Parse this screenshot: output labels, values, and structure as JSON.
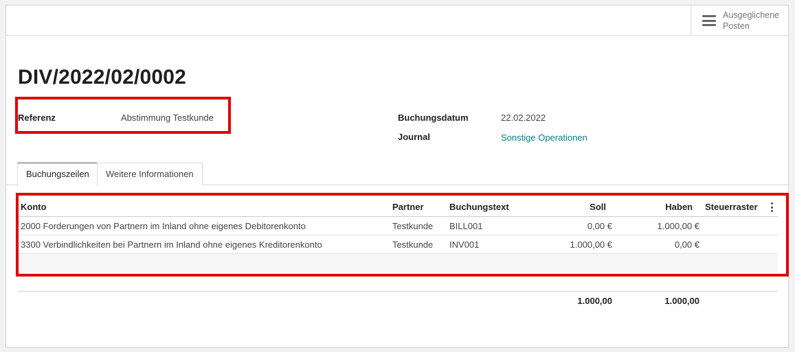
{
  "smart_button": {
    "label": "Ausgeglichene Posten",
    "icon": "list-icon"
  },
  "title": "DIV/2022/02/0002",
  "fields": {
    "referenz_label": "Referenz",
    "referenz_value": "Abstimmung Testkunde",
    "buchungsdatum_label": "Buchungsdatum",
    "buchungsdatum_value": "22.02.2022",
    "journal_label": "Journal",
    "journal_value": "Sonstige Operationen"
  },
  "tabs": [
    {
      "label": "Buchungszeilen",
      "active": true
    },
    {
      "label": "Weitere Informationen",
      "active": false
    }
  ],
  "table": {
    "headers": {
      "konto": "Konto",
      "partner": "Partner",
      "buchungstext": "Buchungstext",
      "soll": "Soll",
      "haben": "Haben",
      "steuerraster": "Steuerraster"
    },
    "rows": [
      {
        "konto": "2000 Forderungen von Partnern im Inland ohne eigenes Debitorenkonto",
        "partner": "Testkunde",
        "buchungstext": "BILL001",
        "soll": "0,00 €",
        "haben": "1.000,00 €",
        "steuerraster": ""
      },
      {
        "konto": "3300 Verbindlichkeiten bei Partnern im Inland ohne eigenes Kreditorenkonto",
        "partner": "Testkunde",
        "buchungstext": "INV001",
        "soll": "1.000,00 €",
        "haben": "0,00 €",
        "steuerraster": ""
      }
    ],
    "totals": {
      "soll": "1.000,00",
      "haben": "1.000,00"
    }
  },
  "colors": {
    "highlight_border": "#e00000",
    "link": "#017e84",
    "active_tab_accent": "#714b67"
  }
}
